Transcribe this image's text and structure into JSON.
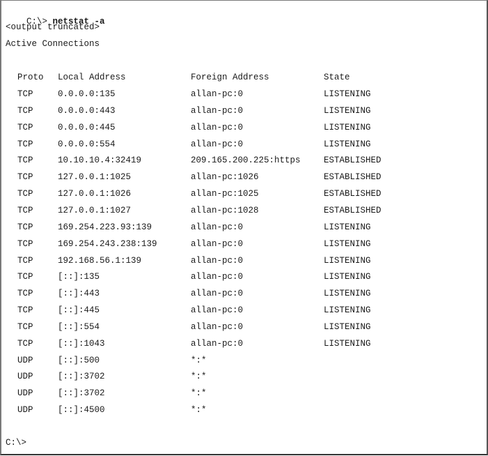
{
  "terminal": {
    "prompt": "C:\\>",
    "command": "netstat -a",
    "notice": "<output truncated>",
    "section_title": "Active Connections",
    "headers": {
      "proto": "Proto",
      "local": "Local Address",
      "foreign": "Foreign Address",
      "state": "State"
    },
    "rows": [
      {
        "proto": "TCP",
        "local": "0.0.0.0:135",
        "foreign": "allan-pc:0",
        "state": "LISTENING"
      },
      {
        "proto": "TCP",
        "local": "0.0.0.0:443",
        "foreign": "allan-pc:0",
        "state": "LISTENING"
      },
      {
        "proto": "TCP",
        "local": "0.0.0.0:445",
        "foreign": "allan-pc:0",
        "state": "LISTENING"
      },
      {
        "proto": "TCP",
        "local": "0.0.0.0:554",
        "foreign": "allan-pc:0",
        "state": "LISTENING"
      },
      {
        "proto": "TCP",
        "local": "10.10.10.4:32419",
        "foreign": "209.165.200.225:https",
        "state": "ESTABLISHED"
      },
      {
        "proto": "TCP",
        "local": "127.0.0.1:1025",
        "foreign": "allan-pc:1026",
        "state": "ESTABLISHED"
      },
      {
        "proto": "TCP",
        "local": "127.0.0.1:1026",
        "foreign": "allan-pc:1025",
        "state": "ESTABLISHED"
      },
      {
        "proto": "TCP",
        "local": "127.0.0.1:1027",
        "foreign": "allan-pc:1028",
        "state": "ESTABLISHED"
      },
      {
        "proto": "TCP",
        "local": "169.254.223.93:139",
        "foreign": "allan-pc:0",
        "state": "LISTENING"
      },
      {
        "proto": "TCP",
        "local": "169.254.243.238:139",
        "foreign": "allan-pc:0",
        "state": "LISTENING"
      },
      {
        "proto": "TCP",
        "local": "192.168.56.1:139",
        "foreign": "allan-pc:0",
        "state": "LISTENING"
      },
      {
        "proto": "TCP",
        "local": "[::]:135",
        "foreign": "allan-pc:0",
        "state": "LISTENING"
      },
      {
        "proto": "TCP",
        "local": "[::]:443",
        "foreign": "allan-pc:0",
        "state": "LISTENING"
      },
      {
        "proto": "TCP",
        "local": "[::]:445",
        "foreign": "allan-pc:0",
        "state": "LISTENING"
      },
      {
        "proto": "TCP",
        "local": "[::]:554",
        "foreign": "allan-pc:0",
        "state": "LISTENING"
      },
      {
        "proto": "TCP",
        "local": "[::]:1043",
        "foreign": "allan-pc:0",
        "state": "LISTENING"
      },
      {
        "proto": "UDP",
        "local": "[::]:500",
        "foreign": "*:*",
        "state": ""
      },
      {
        "proto": "UDP",
        "local": "[::]:3702",
        "foreign": "*:*",
        "state": ""
      },
      {
        "proto": "UDP",
        "local": "[::]:3702",
        "foreign": "*:*",
        "state": ""
      },
      {
        "proto": "UDP",
        "local": "[::]:4500",
        "foreign": "*:*",
        "state": ""
      }
    ],
    "final_prompt": "C:\\>"
  }
}
